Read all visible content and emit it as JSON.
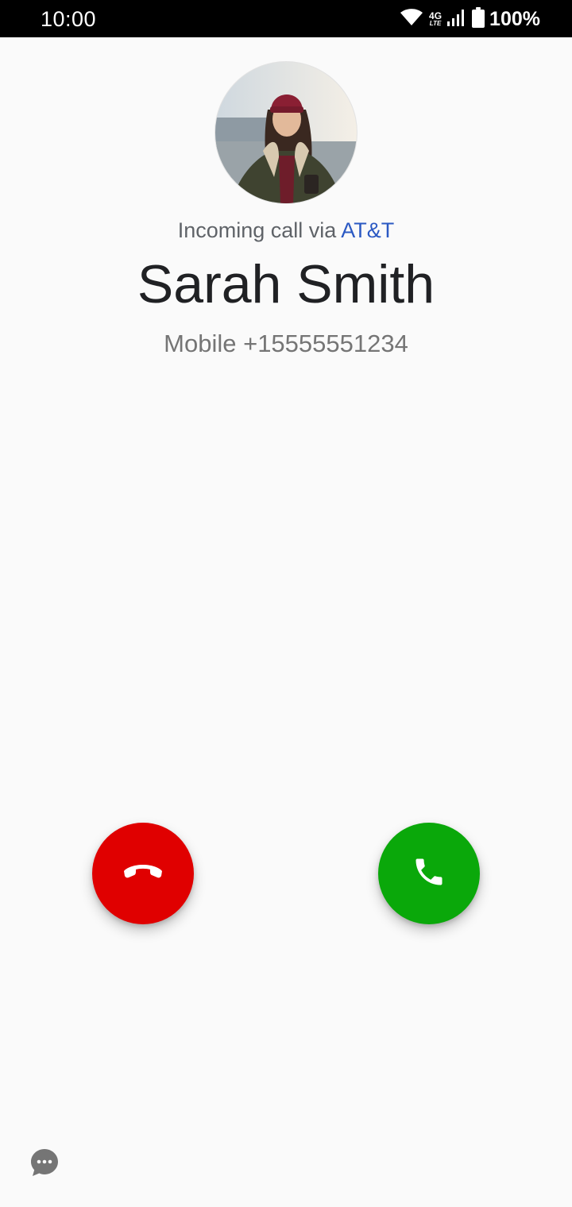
{
  "status_bar": {
    "time": "10:00",
    "network_type": "4G",
    "network_subtype": "LTE",
    "battery_percent": "100%",
    "icons": [
      "wifi-icon",
      "network-type-icon",
      "signal-icon",
      "battery-icon"
    ]
  },
  "call": {
    "via_prefix": "Incoming call via ",
    "carrier": "AT&T",
    "caller_name": "Sarah Smith",
    "caller_number": "Mobile +15555551234"
  },
  "actions": {
    "decline_icon": "call-end-icon",
    "answer_icon": "phone-icon",
    "reply_icon": "message-bubble-icon"
  },
  "colors": {
    "decline": "#e00000",
    "answer": "#0aa80a",
    "carrier_link": "#2b59c3",
    "background": "#fafafa"
  }
}
